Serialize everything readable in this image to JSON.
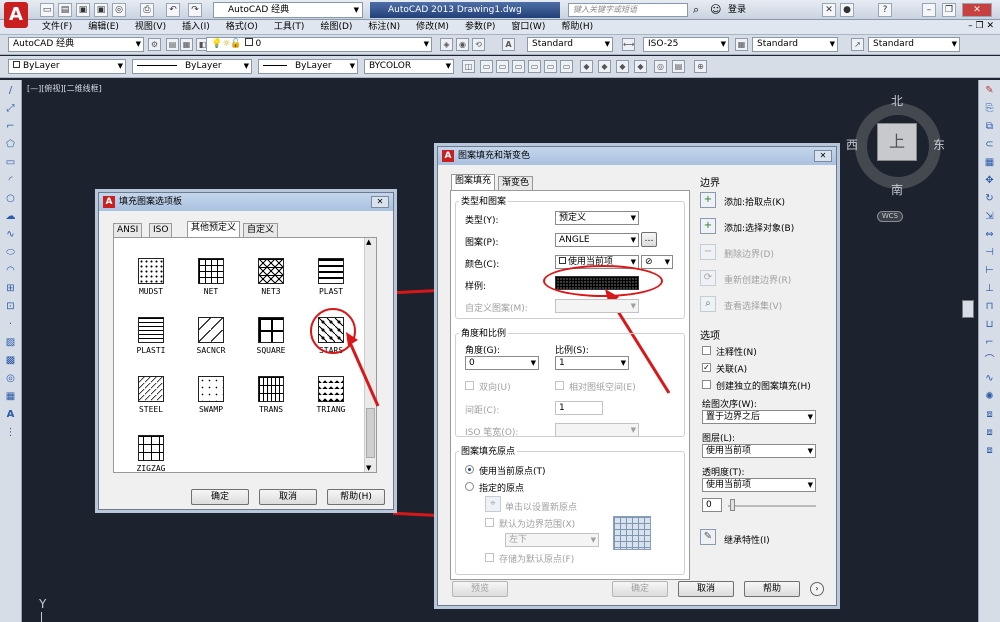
{
  "titlebar": {
    "workspace": "AutoCAD 经典",
    "title": "AutoCAD 2013    Drawing1.dwg",
    "search_placeholder": "键入关键字或短语",
    "login": "登录"
  },
  "menubar": [
    "文件(F)",
    "编辑(E)",
    "视图(V)",
    "插入(I)",
    "格式(O)",
    "工具(T)",
    "绘图(D)",
    "标注(N)",
    "修改(M)",
    "参数(P)",
    "窗口(W)",
    "帮助(H)"
  ],
  "toolbar1": {
    "workspace": "AutoCAD 经典",
    "layer": "0",
    "text_style": "Standard",
    "dim_style": "ISO-25",
    "table_style": "Standard",
    "mleader_style": "Standard"
  },
  "toolbar2": {
    "color": "ByLayer",
    "linetype": "ByLayer",
    "lineweight": "ByLayer",
    "plotstyle": "BYCOLOR"
  },
  "viewport_label": "[—][俯视][二维线框]",
  "viewcube": {
    "north": "北",
    "south": "南",
    "east": "东",
    "west": "西",
    "face": "上",
    "wcs": "WCS"
  },
  "ucs_label": "Y",
  "palette": {
    "title": "填充图案选项板",
    "tabs": [
      "ANSI",
      "ISO",
      "其他预定义",
      "自定义"
    ],
    "patterns": [
      "MUDST",
      "NET",
      "NET3",
      "PLAST",
      "PLASTI",
      "SACNCR",
      "SQUARE",
      "STARS",
      "STEEL",
      "SWAMP",
      "TRANS",
      "TRIANG",
      "ZIGZAG"
    ],
    "ok": "确定",
    "cancel": "取消",
    "help": "帮助(H)"
  },
  "hatch": {
    "title": "图案填充和渐变色",
    "tabs": [
      "图案填充",
      "渐变色"
    ],
    "type_group": "类型和图案",
    "type_label": "类型(Y):",
    "type_value": "预定义",
    "pattern_label": "图案(P):",
    "pattern_value": "ANGLE",
    "color_label": "颜色(C):",
    "color_value": "使用当前项",
    "sample_label": "样例:",
    "custom_label": "自定义图案(M):",
    "angle_group": "角度和比例",
    "angle_label": "角度(G):",
    "angle_value": "0",
    "scale_label": "比例(S):",
    "scale_value": "1",
    "double_label": "双向(U)",
    "relative_label": "相对图纸空间(E)",
    "spacing_label": "间距(C):",
    "spacing_value": "1",
    "iso_label": "ISO 笔宽(O):",
    "origin_group": "图案填充原点",
    "use_current_origin": "使用当前原点(T)",
    "specified_origin": "指定的原点",
    "click_set_origin": "单击以设置新原点",
    "default_boundary": "默认为边界范围(X)",
    "boundary_pos": "左下",
    "store_default": "存储为默认原点(F)",
    "boundary_title": "边界",
    "add_pick": "添加:拾取点(K)",
    "add_select": "添加:选择对象(B)",
    "remove_boundary": "删除边界(D)",
    "recreate_boundary": "重新创建边界(R)",
    "view_selection": "查看选择集(V)",
    "options_title": "选项",
    "annotative": "注释性(N)",
    "associative": "关联(A)",
    "create_separate": "创建独立的图案填充(H)",
    "draw_order_label": "绘图次序(W):",
    "draw_order_value": "置于边界之后",
    "layer_label": "图层(L):",
    "layer_value": "使用当前项",
    "transparency_label": "透明度(T):",
    "transparency_value": "使用当前项",
    "transparency_num": "0",
    "inherit": "继承特性(I)",
    "preview": "预览",
    "ok": "确定",
    "cancel": "取消",
    "help": "帮助"
  }
}
